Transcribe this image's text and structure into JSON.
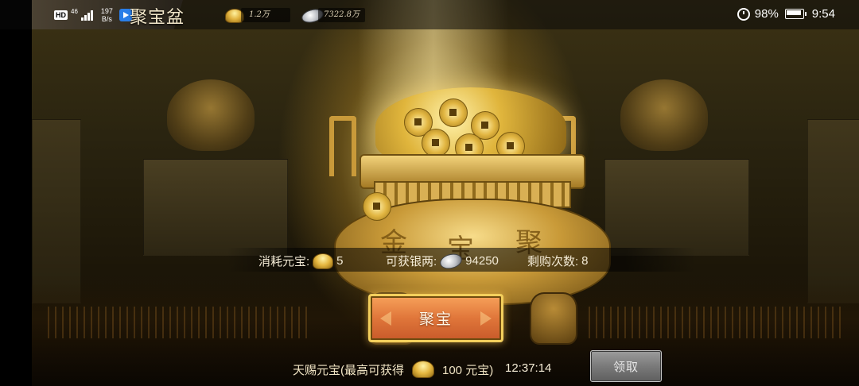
{
  "status_bar": {
    "hd": "HD",
    "network": "46",
    "speed_value": "197",
    "speed_unit": "B/s",
    "battery_percent": "98%",
    "time": "9:54"
  },
  "header": {
    "title": "聚宝盆",
    "gold_amount": "1.2万",
    "silver_amount": "7322.8万"
  },
  "info": {
    "cost_label": "消耗元宝:",
    "cost_value": "5",
    "gain_label": "可获银两:",
    "gain_value": "94250",
    "remaining_label": "剩购次数:",
    "remaining_value": "8"
  },
  "gather_button_label": "聚宝",
  "reward": {
    "prefix": "天赐元宝(最高可获得",
    "amount_suffix": "100 元宝)",
    "timer": "12:37:14",
    "claim_label": "领取"
  },
  "pot_glyphs": [
    "金",
    "聚",
    "宝"
  ],
  "colors": {
    "gold": "#e5b63f",
    "button_orange": "#e0763a",
    "button_border": "#f3cf5c",
    "claim_disabled": "#7a7a7a"
  },
  "icons": {
    "gold_ingot": "gold-ingot-icon",
    "silver_ingot": "silver-ingot-icon"
  }
}
